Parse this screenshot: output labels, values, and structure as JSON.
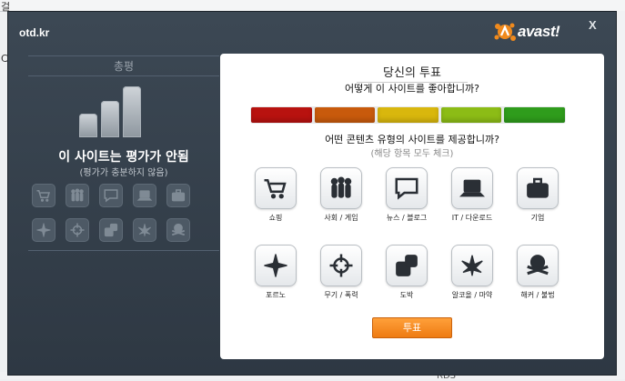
{
  "background": {
    "top_glyph": "걸",
    "left_glyph": "C",
    "bottom_text": "RDS"
  },
  "window": {
    "site": "otd.kr",
    "brand": "avast!",
    "close": "X"
  },
  "left": {
    "title": "총평",
    "rating": "이 사이트는 평가가 안됨",
    "rating_sub": "(평가가 충분하지 않음)",
    "mini_icons": [
      "cart-icon",
      "people-icon",
      "speech-icon",
      "laptop-icon",
      "briefcase-icon",
      "star-icon",
      "crosshair-icon",
      "dice-icon",
      "leaf-icon",
      "skull-icon"
    ]
  },
  "vote": {
    "title": "당신의 투표",
    "question": "어떻게 이 사이트를 좋아합니까?",
    "colors": [
      "#b8120f",
      "#c85a0c",
      "#d9b70d",
      "#8cbc16",
      "#2f9c1c"
    ],
    "content_question": "어떤 콘텐츠 유형의 사이트를 제공합니까?",
    "content_sub": "(해당 항목 모두 체크)",
    "categories": [
      {
        "label": "쇼핑",
        "icon": "cart-icon"
      },
      {
        "label": "사회 / 게임",
        "icon": "people-icon"
      },
      {
        "label": "뉴스 / 블로그",
        "icon": "speech-icon"
      },
      {
        "label": "IT / 다운로드",
        "icon": "laptop-icon"
      },
      {
        "label": "기업",
        "icon": "briefcase-icon"
      },
      {
        "label": "포르노",
        "icon": "star-icon"
      },
      {
        "label": "무기 / 폭력",
        "icon": "crosshair-icon"
      },
      {
        "label": "도박",
        "icon": "dice-icon"
      },
      {
        "label": "알코올 / 마약",
        "icon": "leaf-icon"
      },
      {
        "label": "해커 / 불법",
        "icon": "skull-icon"
      }
    ],
    "submit": "투표"
  }
}
